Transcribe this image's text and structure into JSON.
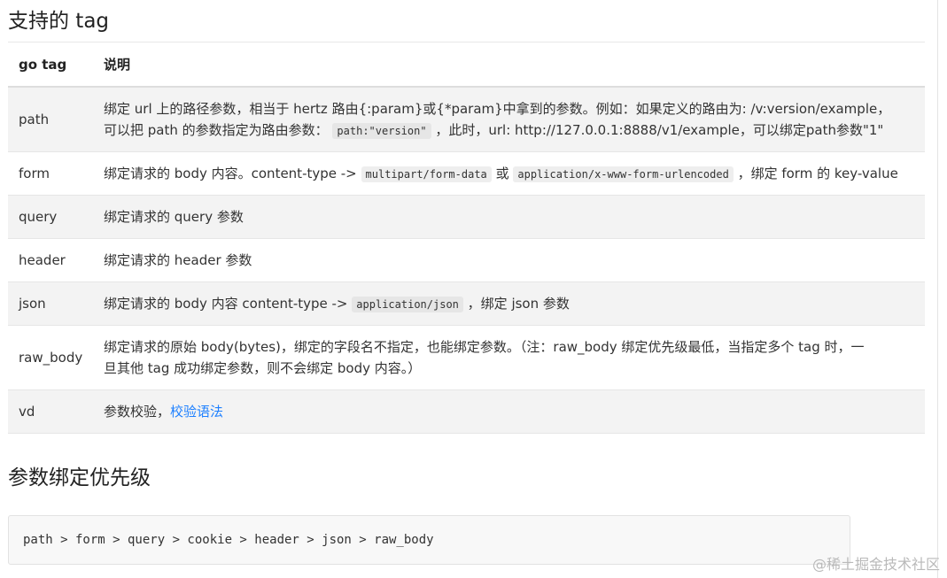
{
  "sections": {
    "tags_heading": "支持的 tag",
    "priority_heading": "参数绑定优先级"
  },
  "table": {
    "headers": [
      "go tag",
      "说明"
    ],
    "rows": [
      {
        "tag": "path",
        "line1": "绑定 url 上的路径参数，相当于 hertz 路由{:param}或{*param}中拿到的参数。例如：如果定义的路由为: /v:version/example，",
        "line2_before": "可以把 path 的参数指定为路由参数：",
        "code": "path:\"version\"",
        "line2_after": "，此时，url: http://127.0.0.1:8888/v1/example，可以绑定path参数\"1\""
      },
      {
        "tag": "form",
        "before": "绑定请求的 body 内容。content-type ->",
        "code1": "multipart/form-data",
        "middle": "或",
        "code2": "application/x-www-form-urlencoded",
        "after": "，绑定 form 的 key-value"
      },
      {
        "tag": "query",
        "text": "绑定请求的 query 参数"
      },
      {
        "tag": "header",
        "text": "绑定请求的 header 参数"
      },
      {
        "tag": "json",
        "before": "绑定请求的 body 内容 content-type ->",
        "code": "application/json",
        "after": "，绑定 json 参数"
      },
      {
        "tag": "raw_body",
        "line1": "绑定请求的原始 body(bytes)，绑定的字段名不指定，也能绑定参数。（注：raw_body 绑定优先级最低，当指定多个 tag 时，一",
        "line2": "旦其他 tag 成功绑定参数，则不会绑定 body 内容。）"
      },
      {
        "tag": "vd",
        "before": "参数校验，",
        "link": "校验语法"
      }
    ]
  },
  "code_block": {
    "text": "path > form > query > cookie > header > json > raw_body"
  },
  "watermark": "@稀土掘金技术社区"
}
